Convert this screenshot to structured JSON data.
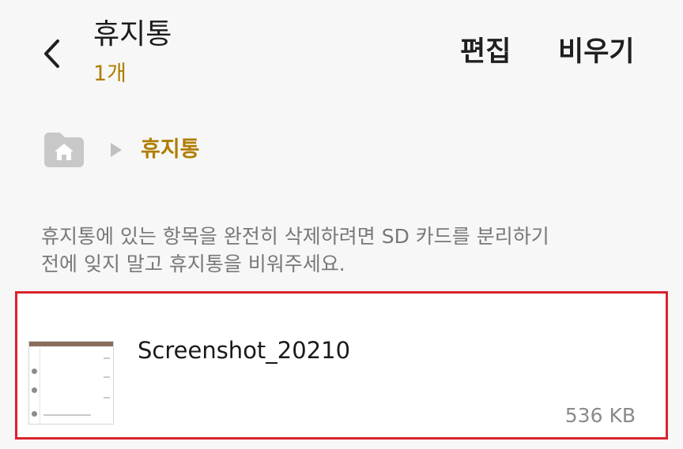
{
  "header": {
    "title": "휴지통",
    "subtitle": "1개",
    "edit_label": "편집",
    "empty_label": "비우기"
  },
  "breadcrumb": {
    "current": "휴지통"
  },
  "info": {
    "line1": "휴지통에 있는 항목을 완전히 삭제하려면 SD 카드를 분리하기",
    "line2": "전에 잊지 말고 휴지통을 비워주세요."
  },
  "files": [
    {
      "name": "Screenshot_20210",
      "size": "536 KB"
    }
  ],
  "icons": {
    "back": "chevron-left-icon",
    "home": "home-folder-icon",
    "separator": "triangle-right-icon"
  },
  "colors": {
    "background": "#f7f7f7",
    "accent": "#b07d00",
    "highlight": "#d9232d",
    "muted_icon": "#c8c8c8"
  }
}
